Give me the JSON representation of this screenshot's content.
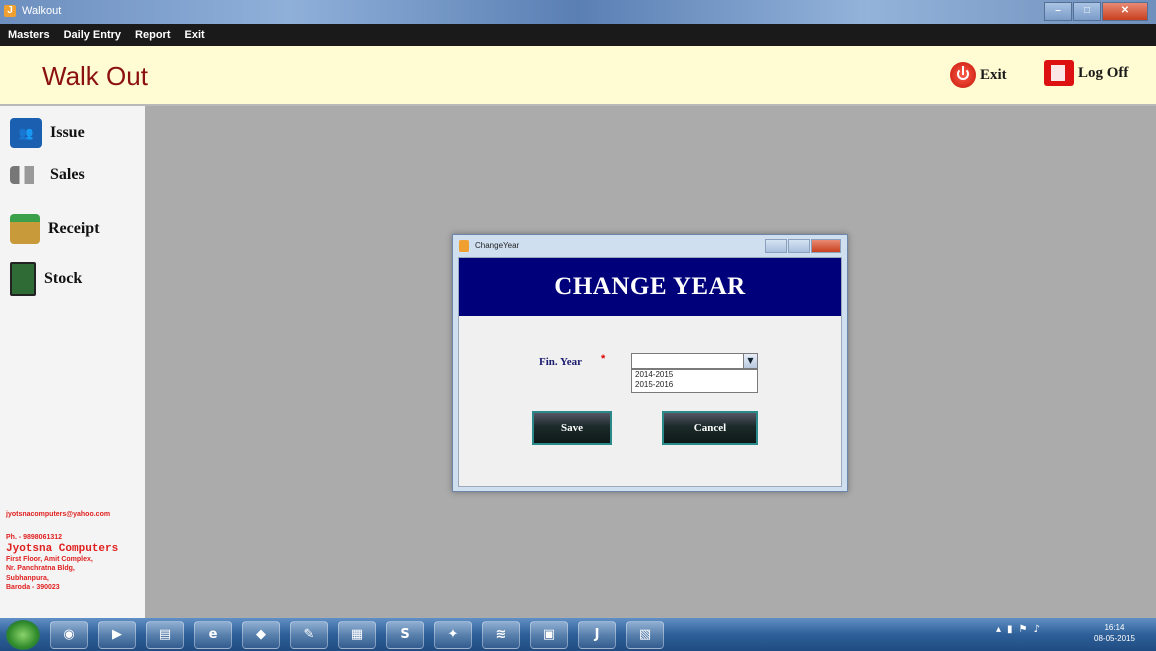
{
  "window": {
    "title": "Walkout",
    "buttons": [
      "–",
      "□",
      "✕"
    ]
  },
  "menubar": {
    "items": [
      "Masters",
      "Daily Entry",
      "Report",
      "Exit"
    ]
  },
  "header": {
    "app_title": "Walk Out",
    "exit_label": "Exit",
    "logoff_label": "Log Off"
  },
  "sidebar": {
    "items": [
      {
        "label": "Issue",
        "icon": "issue-icon"
      },
      {
        "label": "Sales",
        "icon": "sales-icon"
      },
      {
        "label": "Receipt",
        "icon": "receipt-icon"
      },
      {
        "label": "Stock",
        "icon": "stock-icon"
      }
    ],
    "company": {
      "email": "jyotsnacomputers@yahoo.com",
      "phone": "Ph. - 9898061312",
      "name": "Jyotsna Computers",
      "address1": "First Floor, Amit Complex,",
      "address2": "Nr. Panchratna Bldg,",
      "address3": "Subhanpura,",
      "address4": "Baroda - 390023"
    }
  },
  "dialog": {
    "title": "ChangeYear",
    "banner": "CHANGE YEAR",
    "fin_year_label": "Fin. Year",
    "required_mark": "*",
    "select_value": "",
    "options": [
      "2014-2015",
      "2015-2016"
    ],
    "save_label": "Save",
    "cancel_label": "Cancel"
  },
  "taskbar": {
    "clock_time": "16:14",
    "clock_date": "08-05-2015",
    "apps": [
      "chrome-icon",
      "media-icon",
      "folder-icon",
      "ie-icon",
      "app-icon",
      "tools-icon",
      "file-icon",
      "skype-icon",
      "paint-icon",
      "wifi-icon",
      "terminal-icon",
      "calc-icon",
      "walkout-icon",
      "pdf-icon"
    ]
  },
  "colors": {
    "banner": "#00007a",
    "header_bg": "#fffbd2",
    "title_red": "#8b1010",
    "workspace": "#ababab"
  }
}
